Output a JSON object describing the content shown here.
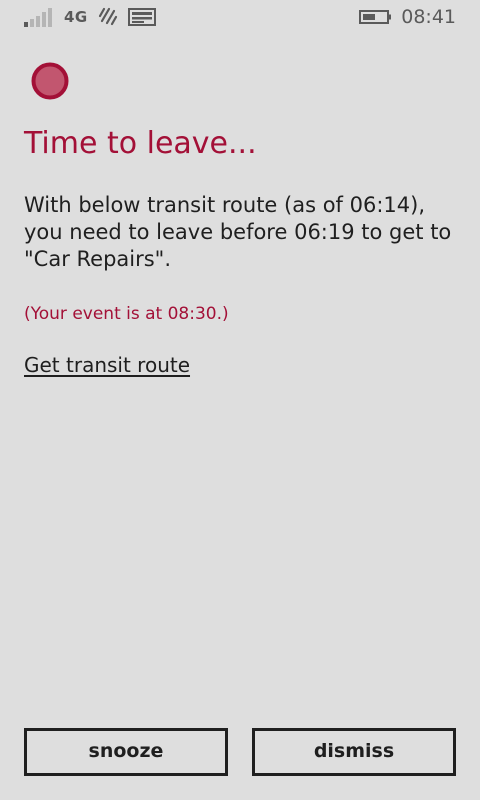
{
  "status_bar": {
    "network_type": "4G",
    "time": "08:41",
    "icons": {
      "signal": "signal-strength-icon",
      "data_sense": "data-sense-icon",
      "message": "message-notification-icon",
      "battery": "battery-icon"
    },
    "signal_bars_filled": 1,
    "signal_bars_total": 5,
    "battery_level": 0.5
  },
  "alarm": {
    "icon": "reminder-bell-icon",
    "title": "Time to leave...",
    "message": "With below transit route (as of 06:14), you need to leave before 06:19 to get to \"Car Repairs\".",
    "event_note": "(Your event is at 08:30.)",
    "route_link": "Get transit route"
  },
  "actions": {
    "snooze_label": "snooze",
    "dismiss_label": "dismiss"
  },
  "colors": {
    "accent": "#a31037",
    "background": "#dedede",
    "text": "#1f1f1f",
    "status_gray": "#5a5a5a"
  }
}
